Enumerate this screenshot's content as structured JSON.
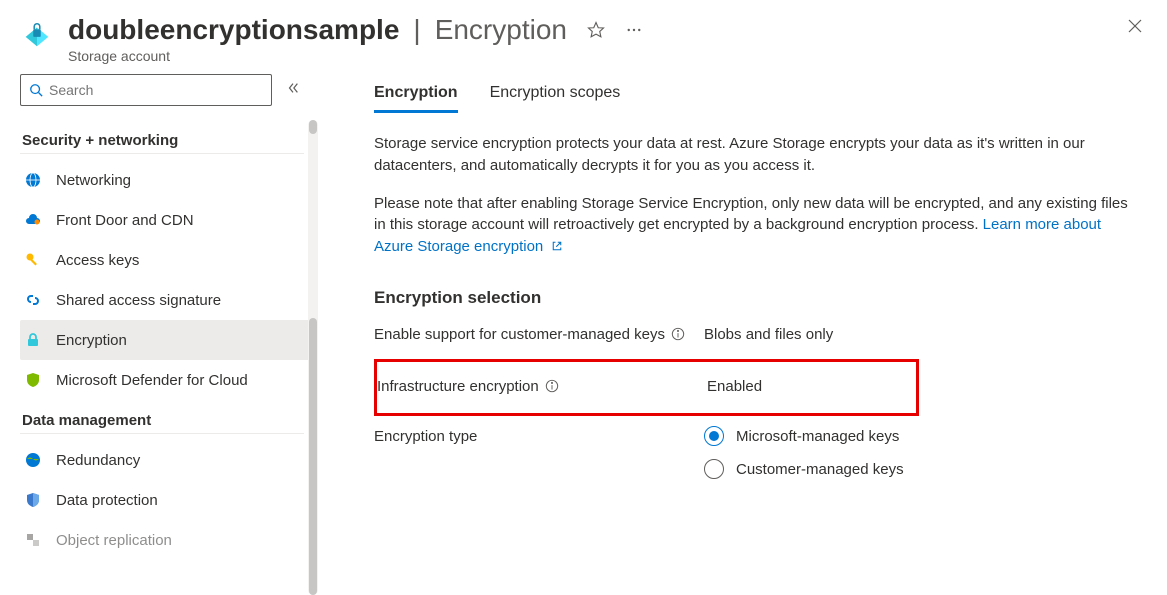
{
  "header": {
    "resource_name": "doubleencryptionsample",
    "separator": "|",
    "page_name": "Encryption",
    "resource_type": "Storage account"
  },
  "search": {
    "placeholder": "Search"
  },
  "sidebar": {
    "sections": [
      {
        "label": "Security + networking",
        "items": [
          {
            "icon": "globe-icon",
            "color": "#0078d4",
            "label": "Networking"
          },
          {
            "icon": "cloud-icon",
            "color": "#0078d4",
            "label": "Front Door and CDN"
          },
          {
            "icon": "key-icon",
            "color": "#ffb900",
            "label": "Access keys"
          },
          {
            "icon": "link-icon",
            "color": "#0078d4",
            "label": "Shared access signature"
          },
          {
            "icon": "lock-icon",
            "color": "#32c8db",
            "label": "Encryption",
            "selected": true
          },
          {
            "icon": "shield-icon",
            "color": "#7fba00",
            "label": "Microsoft Defender for Cloud"
          }
        ]
      },
      {
        "label": "Data management",
        "items": [
          {
            "icon": "globe2-icon",
            "color": "#0078d4",
            "label": "Redundancy"
          },
          {
            "icon": "shield2-icon",
            "color": "#3b79cc",
            "label": "Data protection"
          },
          {
            "icon": "object-icon",
            "color": "#605e5c",
            "label": "Object replication"
          }
        ]
      }
    ]
  },
  "tabs": [
    {
      "label": "Encryption",
      "active": true
    },
    {
      "label": "Encryption scopes",
      "active": false
    }
  ],
  "content": {
    "para1": "Storage service encryption protects your data at rest. Azure Storage encrypts your data as it's written in our datacenters, and automatically decrypts it for you as you access it.",
    "para2": "Please note that after enabling Storage Service Encryption, only new data will be encrypted, and any existing files in this storage account will retroactively get encrypted by a background encryption process. ",
    "learn_more": "Learn more about Azure Storage encryption",
    "section_title": "Encryption selection",
    "rows": {
      "cmk_support": {
        "label": "Enable support for customer-managed keys",
        "value": "Blobs and files only"
      },
      "infra": {
        "label": "Infrastructure encryption",
        "value": "Enabled"
      },
      "enc_type": {
        "label": "Encryption type"
      }
    },
    "radio_options": [
      {
        "label": "Microsoft-managed keys",
        "selected": true
      },
      {
        "label": "Customer-managed keys",
        "selected": false
      }
    ]
  }
}
